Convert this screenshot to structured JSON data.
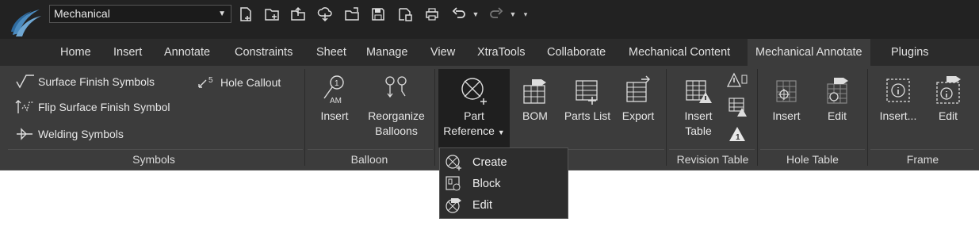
{
  "workspace": {
    "selected": "Mechanical"
  },
  "quick_access": [
    {
      "icon": "new-file-icon"
    },
    {
      "icon": "new-folder-icon"
    },
    {
      "icon": "open-icon"
    },
    {
      "icon": "open-cloud-icon"
    },
    {
      "icon": "import-icon"
    },
    {
      "icon": "save-icon"
    },
    {
      "icon": "save-as-icon"
    },
    {
      "icon": "plot-icon"
    },
    {
      "icon": "undo-icon"
    },
    {
      "icon": "redo-icon"
    }
  ],
  "tabs": [
    {
      "label": "Home"
    },
    {
      "label": "Insert"
    },
    {
      "label": "Annotate"
    },
    {
      "label": "Constraints"
    },
    {
      "label": "Sheet"
    },
    {
      "label": "Manage"
    },
    {
      "label": "View"
    },
    {
      "label": "XtraTools"
    },
    {
      "label": "Collaborate"
    },
    {
      "label": "Mechanical Content"
    },
    {
      "label": "Mechanical Annotate"
    },
    {
      "label": "Plugins"
    }
  ],
  "active_tab": "Mechanical Annotate",
  "panels": {
    "symbols": {
      "title": "Symbols",
      "surface_finish": "Surface Finish Symbols",
      "flip_surface_finish": "Flip Surface Finish Symbol",
      "welding": "Welding Symbols",
      "hole_callout": "Hole Callout"
    },
    "balloon": {
      "title": "Balloon",
      "insert": "Insert",
      "reorganize_line1": "Reorganize",
      "reorganize_line2": "Balloons"
    },
    "bom": {
      "part_reference_line1": "Part",
      "part_reference_line2": "Reference",
      "bom": "BOM",
      "parts_list": "Parts List",
      "export": "Export"
    },
    "revision_table": {
      "title": "Revision Table",
      "insert_line1": "Insert",
      "insert_line2": "Table"
    },
    "hole_table": {
      "title": "Hole Table",
      "insert": "Insert",
      "edit": "Edit"
    },
    "frame": {
      "title": "Frame",
      "insert": "Insert...",
      "edit": "Edit"
    }
  },
  "dropdown": {
    "items": [
      {
        "label": "Create",
        "icon": "part-reference-create-icon"
      },
      {
        "label": "Block",
        "icon": "part-reference-block-icon"
      },
      {
        "label": "Edit",
        "icon": "part-reference-edit-icon"
      }
    ]
  },
  "colors": {
    "titlebar": "#222222",
    "ribbon": "#3c3c3c",
    "accent": "#1e90ff",
    "warning": "#f0f0f0"
  }
}
